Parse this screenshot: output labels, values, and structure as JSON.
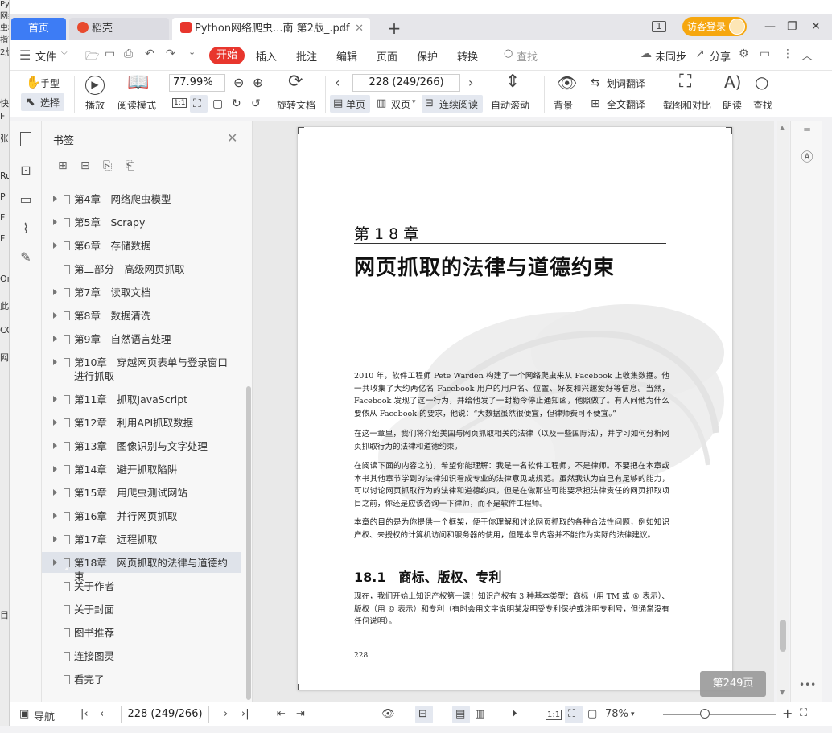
{
  "background_window": {
    "title": "Python网络爬虫权威指南 第2版",
    "side_chars": [
      "快",
      "F",
      "张",
      "Ru",
      "P",
      "F",
      "F",
      "On",
      "此",
      "CO",
      "网",
      "目"
    ]
  },
  "tabs": {
    "home": "首页",
    "daoke": "稻壳",
    "pdf": "Python网络爬虫...南 第2版_.pdf",
    "plus": "+"
  },
  "window": {
    "visitor_login": "访客登录",
    "pages_icon": "1",
    "minimize": "—",
    "restore": "❐",
    "close": "✕"
  },
  "menu": {
    "file": "文件",
    "start": "开始",
    "items": [
      "插入",
      "批注",
      "编辑",
      "页面",
      "保护",
      "转换"
    ],
    "search": "查找",
    "unsynced": "未同步",
    "share": "分享"
  },
  "ribbon": {
    "hand": "手型",
    "select": "选择",
    "play": "播放",
    "read_mode": "阅读模式",
    "zoom": "77.99%",
    "rotate": "旋转文档",
    "page_input": "228 (249/266)",
    "single": "单页",
    "double": "双页",
    "continuous": "连续阅读",
    "auto_scroll": "自动滚动",
    "background": "背景",
    "word_translate": "划词翻译",
    "full_translate": "全文翻译",
    "screenshot_compare": "截图和对比",
    "read_aloud": "朗读",
    "find": "查找"
  },
  "bookmarks": {
    "title": "书签",
    "items": [
      {
        "label": "第4章　网络爬虫模型",
        "arrow": true,
        "selected": false
      },
      {
        "label": "第5章　Scrapy",
        "arrow": true,
        "selected": false
      },
      {
        "label": "第6章　存储数据",
        "arrow": true,
        "selected": false
      },
      {
        "label": "第二部分　高级网页抓取",
        "arrow": false,
        "selected": false
      },
      {
        "label": "第7章　读取文档",
        "arrow": true,
        "selected": false
      },
      {
        "label": "第8章　数据清洗",
        "arrow": true,
        "selected": false
      },
      {
        "label": "第9章　自然语言处理",
        "arrow": true,
        "selected": false
      },
      {
        "label": "第10章　穿越网页表单与登录窗口进行抓取",
        "arrow": true,
        "selected": false,
        "two_line": true
      },
      {
        "label": "第11章　抓取JavaScript",
        "arrow": true,
        "selected": false
      },
      {
        "label": "第12章　利用API抓取数据",
        "arrow": true,
        "selected": false
      },
      {
        "label": "第13章　图像识别与文字处理",
        "arrow": true,
        "selected": false
      },
      {
        "label": "第14章　避开抓取陷阱",
        "arrow": true,
        "selected": false
      },
      {
        "label": "第15章　用爬虫测试网站",
        "arrow": true,
        "selected": false
      },
      {
        "label": "第16章　并行网页抓取",
        "arrow": true,
        "selected": false
      },
      {
        "label": "第17章　远程抓取",
        "arrow": true,
        "selected": false
      },
      {
        "label": "第18章　网页抓取的法律与道德约束",
        "arrow": true,
        "selected": true
      },
      {
        "label": "关于作者",
        "arrow": false,
        "selected": false
      },
      {
        "label": "关于封面",
        "arrow": false,
        "selected": false
      },
      {
        "label": "图书推荐",
        "arrow": false,
        "selected": false
      },
      {
        "label": "连接图灵",
        "arrow": false,
        "selected": false
      },
      {
        "label": "看完了",
        "arrow": false,
        "selected": false
      }
    ]
  },
  "page": {
    "chapter_label": "第 1 8 章",
    "chapter_title": "网页抓取的法律与道德约束",
    "paragraphs": [
      "2010 年，软件工程师 Pete Warden 构建了一个网络爬虫来从 Facebook 上收集数据。他一共收集了大约两亿名 Facebook 用户的用户名、位置、好友和兴趣爱好等信息。当然，Facebook 发现了这一行为，并给他发了一封勒令停止通知函，他照做了。有人问他为什么要依从 Facebook 的要求，他说：“大数据虽然很便宜，但律师费可不便宜。”",
      "在这一章里，我们将介绍美国与网页抓取相关的法律（以及一些国际法），并学习如何分析网页抓取行为的法律和道德约束。",
      "在阅读下面的内容之前，希望你能理解：我是一名软件工程师，不是律师。不要把在本章或本书其他章节学到的法律知识看成专业的法律意见或规范。虽然我认为自己有足够的能力，可以讨论网页抓取行为的法律和道德约束，但是在做那些可能要承担法律责任的网页抓取项目之前，你还是应该咨询一下律师，而不是软件工程师。",
      "本章的目的是为你提供一个框架，便于你理解和讨论网页抓取的各种合法性问题，例如知识产权、未授权的计算机访问和服务器的使用，但是本章内容并不能作为实际的法律建议。"
    ],
    "section_title": "18.1　商标、版权、专利",
    "section_paragraph": "现在，我们开始上知识产权第一课！知识产权有 3 种基本类型：商标（用 TM 或 ® 表示）、版权（用 © 表示）和专利（有时会用文字说明某发明受专利保护或注明专利号，但通常没有任何说明）。",
    "page_number": "228",
    "page_badge": "第249页"
  },
  "status": {
    "nav": "导航",
    "page_input": "228 (249/266)",
    "zoom": "78%",
    "ratio": "1:1"
  }
}
